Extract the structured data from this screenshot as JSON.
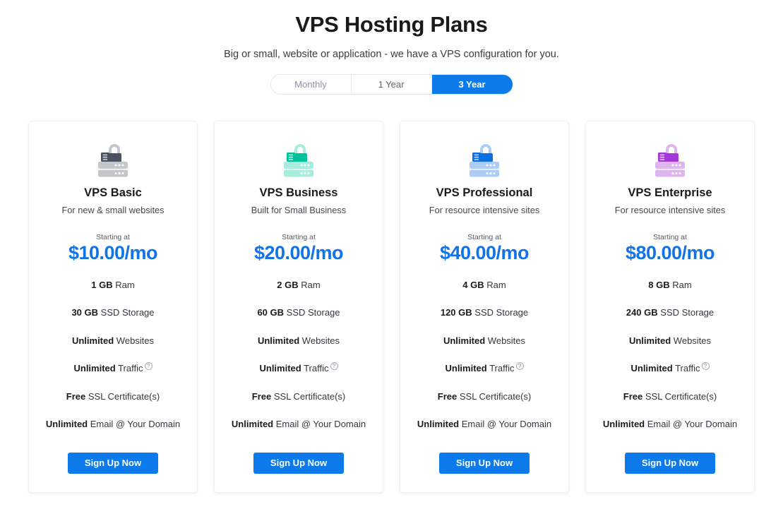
{
  "header": {
    "title": "VPS Hosting Plans",
    "subtitle": "Big or small, website or application - we have a VPS configuration for you."
  },
  "billing_toggle": {
    "options": [
      {
        "label": "Monthly",
        "active": false
      },
      {
        "label": "1 Year",
        "active": false
      },
      {
        "label": "3 Year",
        "active": true
      }
    ],
    "active_color": "#0d7aeb",
    "inactive_text_color": "#8d949d"
  },
  "labels": {
    "starting_at": "Starting at",
    "signup": "Sign Up Now",
    "help_icon": "?"
  },
  "plans": [
    {
      "name": "VPS Basic",
      "tagline": "For new & small websites",
      "price": "$10.00/mo",
      "icon": "server-lock-icon",
      "icon_color_dark": "#4a5160",
      "icon_color_light": "#c3c7cc",
      "features": [
        {
          "strong": "1 GB",
          "rest": " Ram",
          "help": false
        },
        {
          "strong": "30 GB",
          "rest": " SSD Storage",
          "help": false
        },
        {
          "strong": "Unlimited",
          "rest": " Websites",
          "help": false
        },
        {
          "strong": "Unlimited",
          "rest": " Traffic",
          "help": true
        },
        {
          "strong": "Free",
          "rest": " SSL Certificate(s)",
          "help": false
        },
        {
          "strong": "Unlimited",
          "rest": " Email @ Your Domain",
          "help": false
        }
      ]
    },
    {
      "name": "VPS Business",
      "tagline": "Built for Small Business",
      "price": "$20.00/mo",
      "icon": "server-lock-icon",
      "icon_color_dark": "#00c39a",
      "icon_color_light": "#a8ecdd",
      "features": [
        {
          "strong": "2 GB",
          "rest": " Ram",
          "help": false
        },
        {
          "strong": "60 GB",
          "rest": " SSD Storage",
          "help": false
        },
        {
          "strong": "Unlimited",
          "rest": " Websites",
          "help": false
        },
        {
          "strong": "Unlimited",
          "rest": " Traffic",
          "help": true
        },
        {
          "strong": "Free",
          "rest": " SSL Certificate(s)",
          "help": false
        },
        {
          "strong": "Unlimited",
          "rest": " Email @ Your Domain",
          "help": false
        }
      ]
    },
    {
      "name": "VPS Professional",
      "tagline": "For resource intensive sites",
      "price": "$40.00/mo",
      "icon": "server-lock-icon",
      "icon_color_dark": "#0b6fe0",
      "icon_color_light": "#adcdf7",
      "features": [
        {
          "strong": "4 GB",
          "rest": " Ram",
          "help": false
        },
        {
          "strong": "120 GB",
          "rest": " SSD Storage",
          "help": false
        },
        {
          "strong": "Unlimited",
          "rest": " Websites",
          "help": false
        },
        {
          "strong": "Unlimited",
          "rest": " Traffic",
          "help": true
        },
        {
          "strong": "Free",
          "rest": " SSL Certificate(s)",
          "help": false
        },
        {
          "strong": "Unlimited",
          "rest": " Email @ Your Domain",
          "help": false
        }
      ]
    },
    {
      "name": "VPS Enterprise",
      "tagline": "For resource intensive sites",
      "price": "$80.00/mo",
      "icon": "server-lock-icon",
      "icon_color_dark": "#a438d8",
      "icon_color_light": "#ddb6ef",
      "features": [
        {
          "strong": "8 GB",
          "rest": " Ram",
          "help": false
        },
        {
          "strong": "240 GB",
          "rest": " SSD Storage",
          "help": false
        },
        {
          "strong": "Unlimited",
          "rest": " Websites",
          "help": false
        },
        {
          "strong": "Unlimited",
          "rest": " Traffic",
          "help": true
        },
        {
          "strong": "Free",
          "rest": " SSL Certificate(s)",
          "help": false
        },
        {
          "strong": "Unlimited",
          "rest": " Email @ Your Domain",
          "help": false
        }
      ]
    }
  ]
}
